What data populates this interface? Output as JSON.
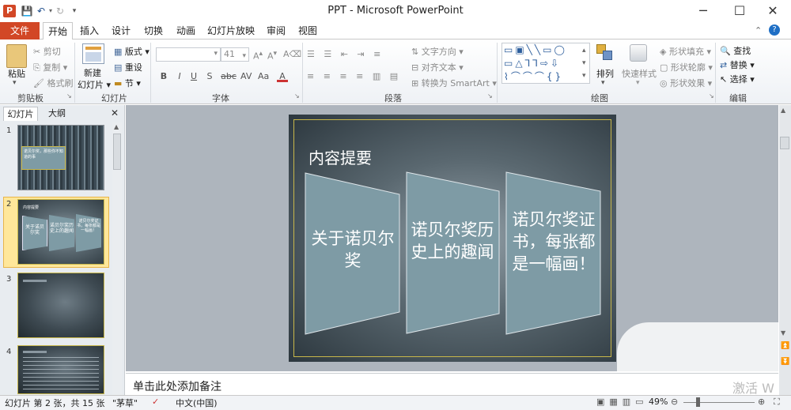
{
  "window": {
    "title": "PPT - Microsoft PowerPoint",
    "app_icon": "P",
    "qat": [
      "save-icon",
      "undo-icon",
      "redo-icon",
      "customize-icon"
    ],
    "controls": [
      "─",
      "☐",
      "✕"
    ]
  },
  "tabs": [
    "文件",
    "开始",
    "插入",
    "设计",
    "切换",
    "动画",
    "幻灯片放映",
    "审阅",
    "视图"
  ],
  "ribbon": {
    "clipboard": {
      "paste": "粘贴",
      "cut": "剪切",
      "copy": "复制",
      "format_painter": "格式刷",
      "label": "剪贴板"
    },
    "slides": {
      "new_slide": "新建",
      "new_slide_2": "幻灯片",
      "layout": "版式",
      "reset": "重设",
      "section": "节",
      "label": "幻灯片"
    },
    "font": {
      "font_size": "41",
      "label": "字体",
      "bold": "B",
      "italic": "I",
      "underline": "U",
      "strike": "S",
      "shadow": "abc"
    },
    "paragraph": {
      "text_direction": "文字方向",
      "align_text": "对齐文本",
      "smartart": "转换为 SmartArt",
      "label": "段落"
    },
    "drawing": {
      "arrange": "排列",
      "quick_styles": "快速样式",
      "shape_fill": "形状填充",
      "shape_outline": "形状轮廓",
      "shape_effects": "形状效果",
      "label": "绘图"
    },
    "editing": {
      "find": "查找",
      "replace": "替换",
      "select": "选择",
      "label": "编辑"
    }
  },
  "panel": {
    "tabs": [
      "幻灯片",
      "大纲"
    ],
    "close": "✕",
    "thumb_numbers": [
      "1",
      "2",
      "3",
      "4"
    ],
    "thumb1_text": "诺贝尔奖，那些你不知道的事",
    "thumb2_shapes": [
      "关于诺贝尔奖",
      "诺贝尔奖历史上的趣闻",
      "诺贝尔奖证书，每张都是一幅画！"
    ],
    "thumb2_title": "内容提要"
  },
  "slide": {
    "title": "内容提要",
    "shapes": [
      "关于诺贝尔奖",
      "诺贝尔奖历史上的趣闻",
      "诺贝尔奖证书，每张都是一幅画！"
    ]
  },
  "notes": {
    "placeholder": "单击此处添加备注"
  },
  "status": {
    "slide_info": "幻灯片 第 2 张，共 15 张",
    "theme": "\"茅草\"",
    "language": "中文(中国)",
    "zoom": "49%"
  },
  "watermark": "激活 W",
  "colors": {
    "file_tab": "#d24726",
    "slide_shape": "#7e9ba5",
    "slide_border": "#c8b74a",
    "selected_thumb": "#ffe79a"
  }
}
